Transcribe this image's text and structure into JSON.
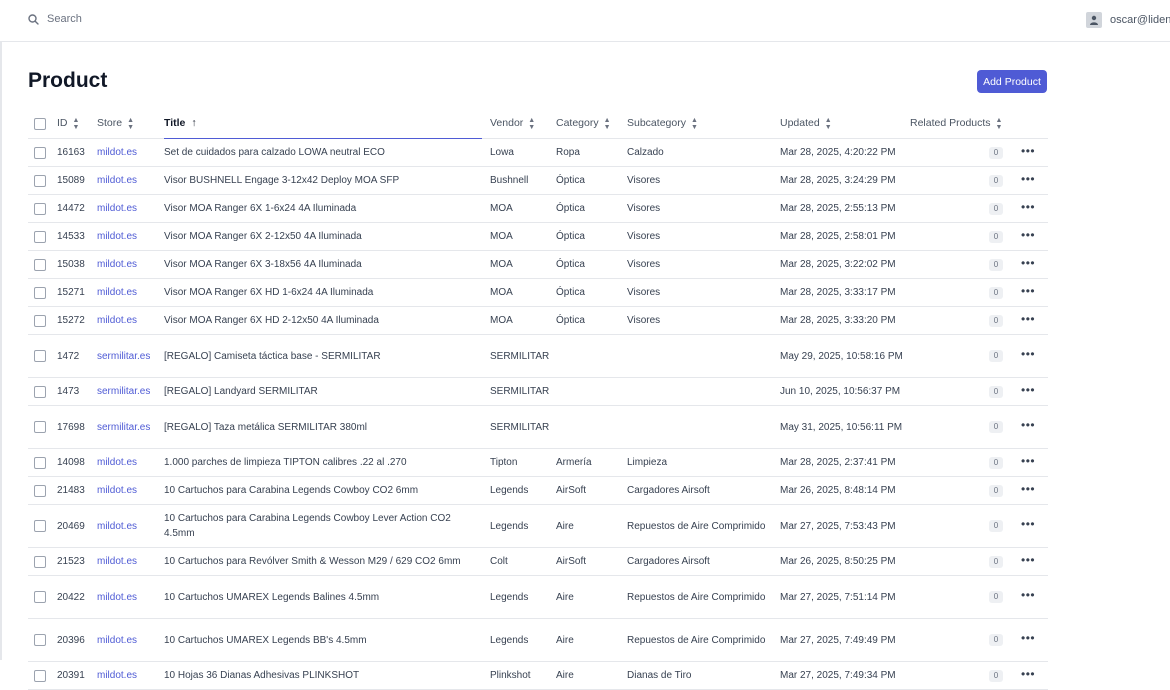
{
  "search": {
    "placeholder": "Search"
  },
  "user": {
    "email": "oscar@lidenc"
  },
  "page": {
    "title": "Product",
    "add_button": "Add Product"
  },
  "columns": {
    "id": "ID",
    "store": "Store",
    "title": "Title",
    "vendor": "Vendor",
    "category": "Category",
    "subcategory": "Subcategory",
    "updated": "Updated",
    "related": "Related Products"
  },
  "icons": {
    "search": "search-icon",
    "user": "user-icon",
    "sort": "sort-icon",
    "sort_asc": "arrow-up-icon",
    "menu": "ellipsis-icon"
  },
  "colors": {
    "accent": "#4f5bd5",
    "link": "#4f5bd5"
  },
  "rows": [
    {
      "id": "16163",
      "store": "mildot.es",
      "title": "Set de cuidados para calzado LOWA neutral ECO",
      "vendor": "Lowa",
      "category": "Ropa",
      "subcategory": "Calzado",
      "updated": "Mar 28, 2025, 4:20:22 PM",
      "related": "0"
    },
    {
      "id": "15089",
      "store": "mildot.es",
      "title": "Visor BUSHNELL Engage 3-12x42 Deploy MOA SFP",
      "vendor": "Bushnell",
      "category": "Óptica",
      "subcategory": "Visores",
      "updated": "Mar 28, 2025, 3:24:29 PM",
      "related": "0"
    },
    {
      "id": "14472",
      "store": "mildot.es",
      "title": "Visor MOA Ranger 6X 1-6x24 4A Iluminada",
      "vendor": "MOA",
      "category": "Óptica",
      "subcategory": "Visores",
      "updated": "Mar 28, 2025, 2:55:13 PM",
      "related": "0"
    },
    {
      "id": "14533",
      "store": "mildot.es",
      "title": "Visor MOA Ranger 6X 2-12x50 4A Iluminada",
      "vendor": "MOA",
      "category": "Óptica",
      "subcategory": "Visores",
      "updated": "Mar 28, 2025, 2:58:01 PM",
      "related": "0"
    },
    {
      "id": "15038",
      "store": "mildot.es",
      "title": "Visor MOA Ranger 6X 3-18x56 4A Iluminada",
      "vendor": "MOA",
      "category": "Óptica",
      "subcategory": "Visores",
      "updated": "Mar 28, 2025, 3:22:02 PM",
      "related": "0"
    },
    {
      "id": "15271",
      "store": "mildot.es",
      "title": "Visor MOA Ranger 6X HD 1-6x24 4A Iluminada",
      "vendor": "MOA",
      "category": "Óptica",
      "subcategory": "Visores",
      "updated": "Mar 28, 2025, 3:33:17 PM",
      "related": "0"
    },
    {
      "id": "15272",
      "store": "mildot.es",
      "title": "Visor MOA Ranger 6X HD 2-12x50 4A Iluminada",
      "vendor": "MOA",
      "category": "Óptica",
      "subcategory": "Visores",
      "updated": "Mar 28, 2025, 3:33:20 PM",
      "related": "0"
    },
    {
      "id": "1472",
      "store": "sermilitar.es",
      "title": "[REGALO] Camiseta táctica base - SERMILITAR",
      "vendor": "SERMILITAR",
      "category": "",
      "subcategory": "",
      "updated": "May 29, 2025, 10:58:16 PM",
      "related": "0"
    },
    {
      "id": "1473",
      "store": "sermilitar.es",
      "title": "[REGALO] Landyard SERMILITAR",
      "vendor": "SERMILITAR",
      "category": "",
      "subcategory": "",
      "updated": "Jun 10, 2025, 10:56:37 PM",
      "related": "0"
    },
    {
      "id": "17698",
      "store": "sermilitar.es",
      "title": "[REGALO] Taza metálica SERMILITAR 380ml",
      "vendor": "SERMILITAR",
      "category": "",
      "subcategory": "",
      "updated": "May 31, 2025, 10:56:11 PM",
      "related": "0"
    },
    {
      "id": "14098",
      "store": "mildot.es",
      "title": "1.000 parches de limpieza TIPTON calibres .22 al .270",
      "vendor": "Tipton",
      "category": "Armería",
      "subcategory": "Limpieza",
      "updated": "Mar 28, 2025, 2:37:41 PM",
      "related": "0"
    },
    {
      "id": "21483",
      "store": "mildot.es",
      "title": "10 Cartuchos para Carabina Legends Cowboy CO2 6mm",
      "vendor": "Legends",
      "category": "AirSoft",
      "subcategory": "Cargadores Airsoft",
      "updated": "Mar 26, 2025, 8:48:14 PM",
      "related": "0"
    },
    {
      "id": "20469",
      "store": "mildot.es",
      "title": "10 Cartuchos para Carabina Legends Cowboy Lever Action CO2 4.5mm",
      "vendor": "Legends",
      "category": "Aire",
      "subcategory": "Repuestos de Aire Comprimido",
      "updated": "Mar 27, 2025, 7:53:43 PM",
      "related": "0"
    },
    {
      "id": "21523",
      "store": "mildot.es",
      "title": "10 Cartuchos para Revólver Smith & Wesson M29 / 629 CO2 6mm",
      "vendor": "Colt",
      "category": "AirSoft",
      "subcategory": "Cargadores Airsoft",
      "updated": "Mar 26, 2025, 8:50:25 PM",
      "related": "0"
    },
    {
      "id": "20422",
      "store": "mildot.es",
      "title": "10 Cartuchos UMAREX Legends Balines 4.5mm",
      "vendor": "Legends",
      "category": "Aire",
      "subcategory": "Repuestos de Aire Comprimido",
      "updated": "Mar 27, 2025, 7:51:14 PM",
      "related": "0"
    },
    {
      "id": "20396",
      "store": "mildot.es",
      "title": "10 Cartuchos UMAREX Legends BB's 4.5mm",
      "vendor": "Legends",
      "category": "Aire",
      "subcategory": "Repuestos de Aire Comprimido",
      "updated": "Mar 27, 2025, 7:49:49 PM",
      "related": "0"
    },
    {
      "id": "20391",
      "store": "mildot.es",
      "title": "10 Hojas 36 Dianas Adhesivas PLINKSHOT",
      "vendor": "Plinkshot",
      "category": "Aire",
      "subcategory": "Dianas de Tiro",
      "updated": "Mar 27, 2025, 7:49:34 PM",
      "related": "0"
    }
  ]
}
